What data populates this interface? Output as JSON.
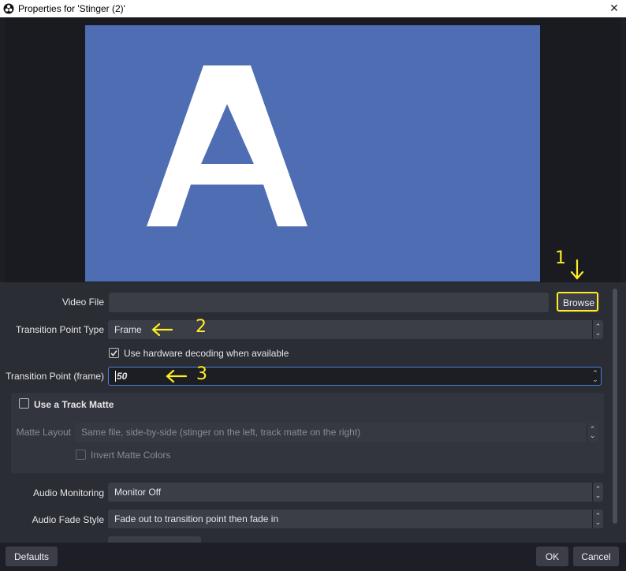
{
  "window": {
    "title": "Properties for 'Stinger (2)'"
  },
  "preview": {
    "letter": "A"
  },
  "form": {
    "video_file": {
      "label": "Video File",
      "value": "",
      "browse_label": "Browse"
    },
    "transition_point_type": {
      "label": "Transition Point Type",
      "value": "Frame"
    },
    "hardware_decoding": {
      "label": "Use hardware decoding when available",
      "checked": true
    },
    "transition_point_frame": {
      "label": "Transition Point (frame)",
      "value": "50"
    },
    "track_matte": {
      "label": "Use a Track Matte",
      "matte_layout_label": "Matte Layout",
      "matte_layout_value": "Same file, side-by-side (stinger on the left, track matte on the right)",
      "invert_label": "Invert Matte Colors"
    },
    "audio_monitoring": {
      "label": "Audio Monitoring",
      "value": "Monitor Off"
    },
    "audio_fade_style": {
      "label": "Audio Fade Style",
      "value": "Fade out to transition point then fade in"
    }
  },
  "buttons": {
    "defaults": "Defaults",
    "ok": "OK",
    "cancel": "Cancel"
  },
  "annotations": {
    "one": "1",
    "two": "2",
    "three": "3"
  },
  "colors": {
    "preview_bg": "#4f6db2",
    "annotation": "#ffee22",
    "focus_border": "#4a7fd8"
  }
}
